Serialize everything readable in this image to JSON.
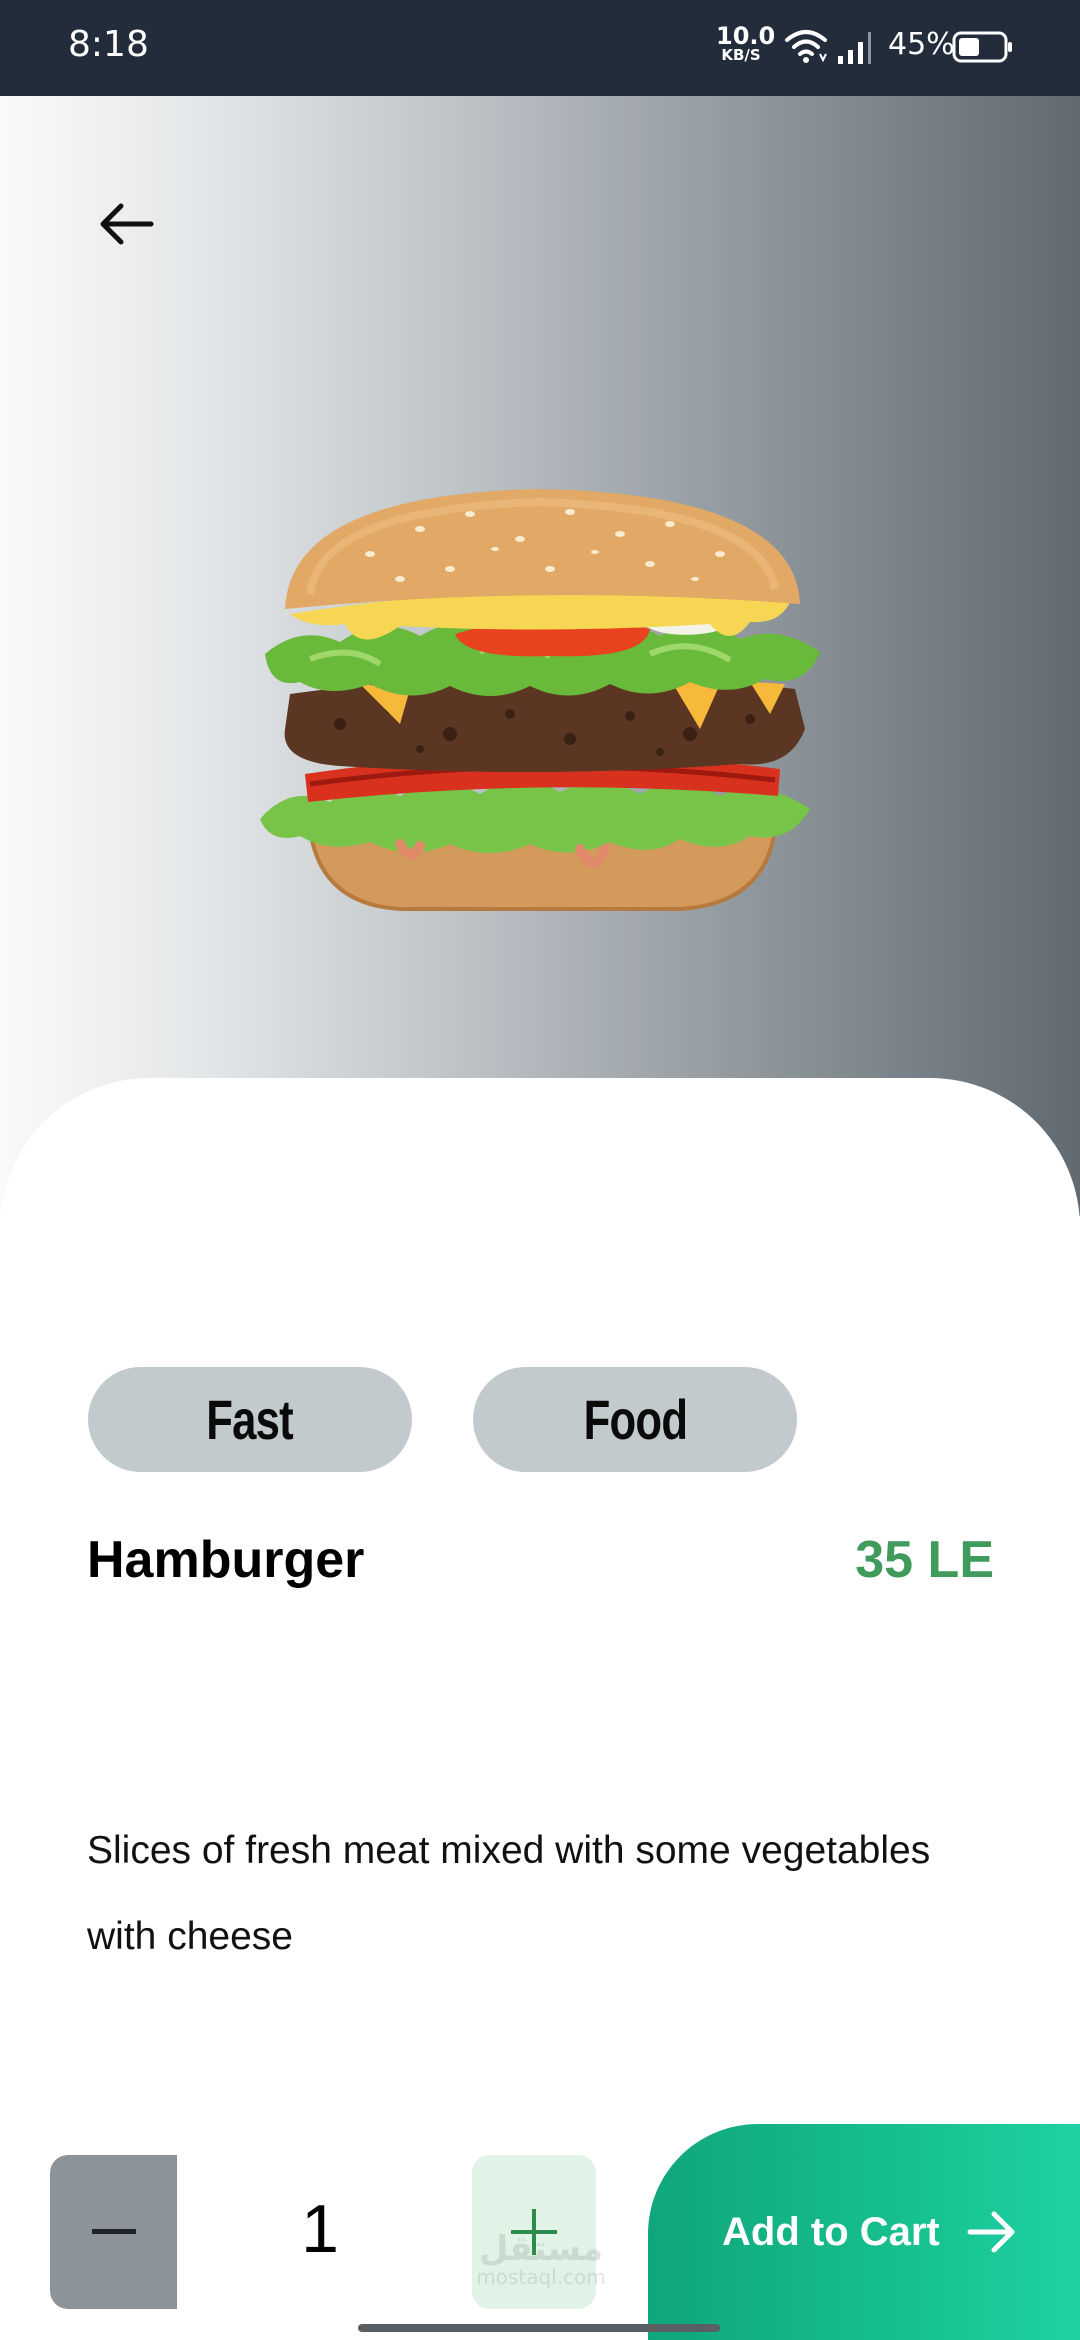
{
  "status_bar": {
    "time": "8:18",
    "speed_value": "10.0",
    "speed_unit": "KB/S",
    "battery_percent": "45%",
    "icons": [
      "wifi-icon",
      "signal-icon",
      "battery-icon"
    ]
  },
  "header": {
    "back_icon": "arrow-left-icon"
  },
  "product": {
    "image": "hamburger",
    "tags": [
      "Fast",
      "Food"
    ],
    "name": "Hamburger",
    "price": "35 LE",
    "description": "Slices of fresh meat mixed with some vegetables with cheese"
  },
  "cart_controls": {
    "quantity": "1",
    "minus_icon": "minus-icon",
    "plus_icon": "plus-icon",
    "add_label": "Add to Cart",
    "add_icon": "arrow-right-icon"
  },
  "watermark": {
    "arabic": "مستقل",
    "latin": "mostaql.com"
  },
  "colors": {
    "status_bar": "#222c3b",
    "price": "#3f9a5c",
    "tag_bg": "#c3cacd",
    "minus_bg": "#8c9399",
    "plus_bg": "#dff3e6",
    "cart_button": "#16c08f"
  }
}
